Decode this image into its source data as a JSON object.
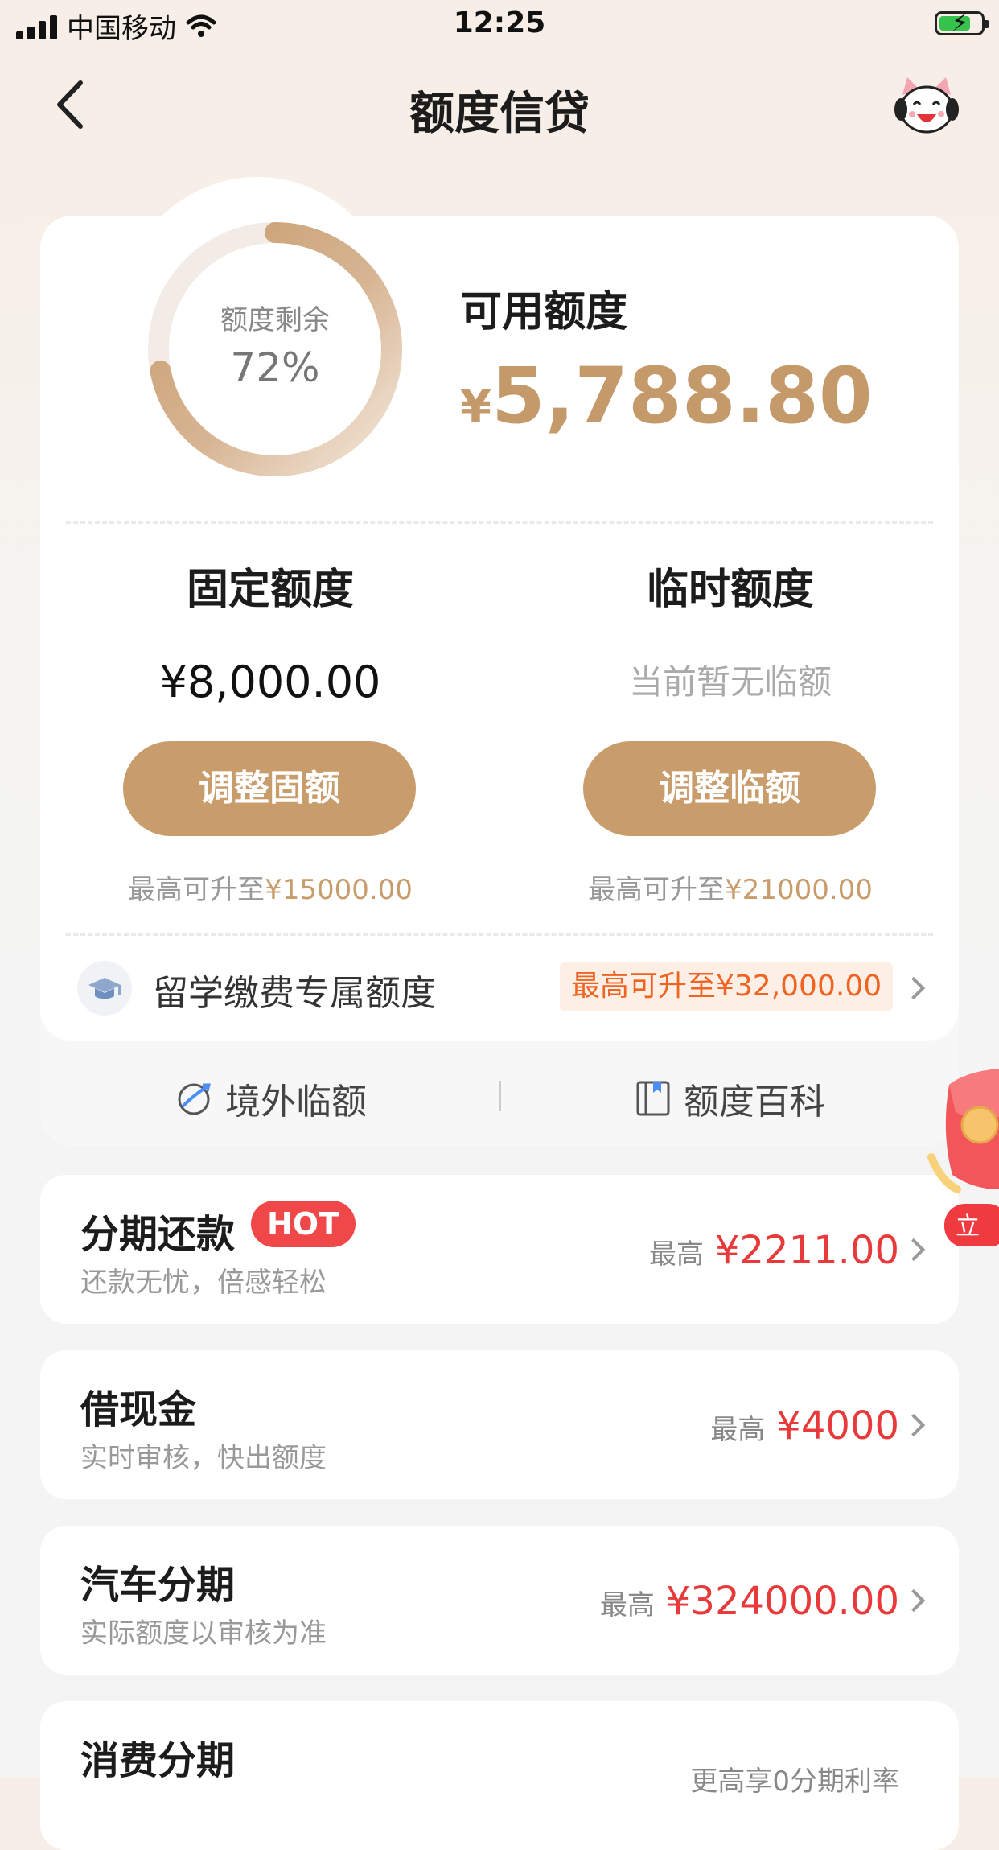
{
  "status_bar": {
    "carrier": "中国移动",
    "time": "12:25"
  },
  "nav": {
    "title": "额度信贷"
  },
  "summary": {
    "ring_label": "额度剩余",
    "ring_percent": "72%",
    "ring_fraction": 0.72,
    "available_label": "可用额度",
    "available_currency": "¥",
    "available_amount": "5,788.80"
  },
  "fixed": {
    "title": "固定额度",
    "amount": "¥8,000.00",
    "button": "调整固额",
    "max_prefix": "最高可升至",
    "max_value": "¥15000.00"
  },
  "temporary": {
    "title": "临时额度",
    "status": "当前暂无临额",
    "button": "调整临额",
    "max_prefix": "最高可升至",
    "max_value": "¥21000.00"
  },
  "edu": {
    "label": "留学缴费专属额度",
    "tag": "最高可升至¥32,000.00"
  },
  "links": {
    "overseas": "境外临额",
    "wiki": "额度百科"
  },
  "products": [
    {
      "title": "分期还款",
      "badge": "HOT",
      "subtitle": "还款无忧，倍感轻松",
      "prefix": "最高",
      "amount": "¥2211.00"
    },
    {
      "title": "借现金",
      "subtitle": "实时审核，快出额度",
      "prefix": "最高",
      "amount": "¥4000"
    },
    {
      "title": "汽车分期",
      "subtitle": "实际额度以审核为准",
      "prefix": "最高",
      "amount": "¥324000.00"
    },
    {
      "title": "消费分期",
      "subtitle": "",
      "prefix": "更高享0分期利率",
      "amount": ""
    }
  ],
  "float_badge": "立",
  "colors": {
    "accent_gold": "#c99d6b",
    "hot_red": "#f04848",
    "amount_red": "#e83a3a",
    "tag_orange": "#f06422"
  }
}
